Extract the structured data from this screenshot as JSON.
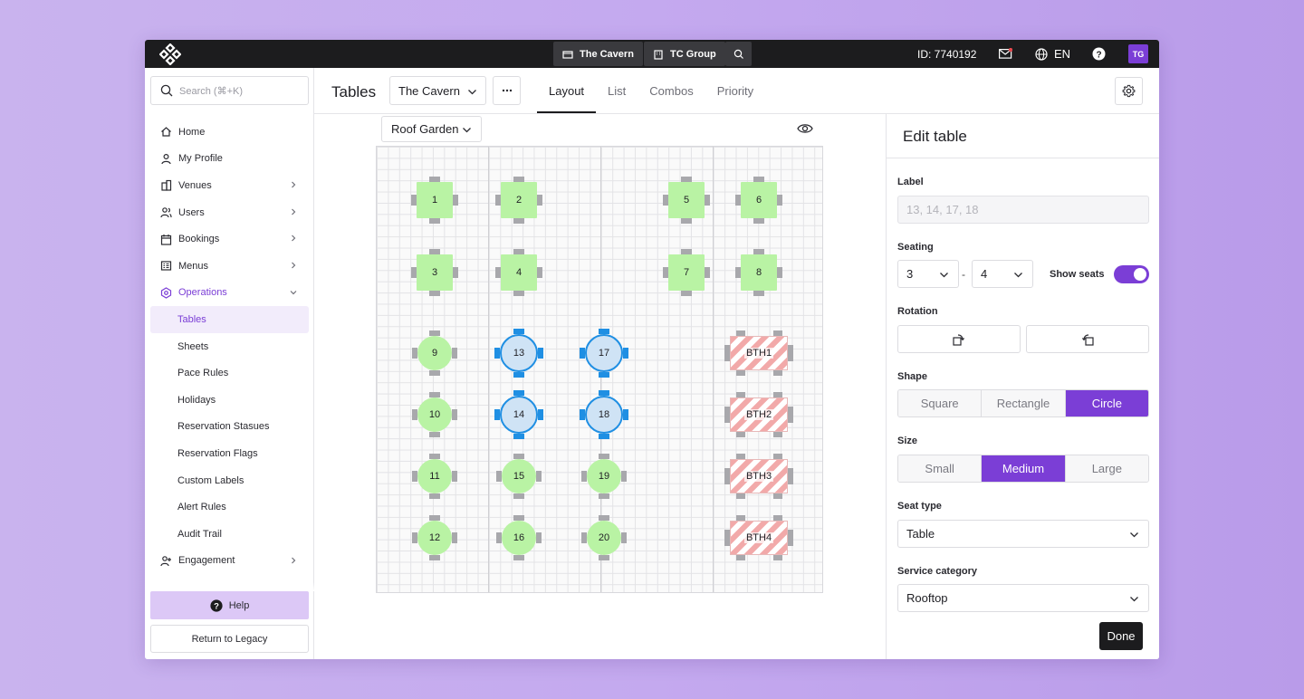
{
  "topbar": {
    "venue_label": "The Cavern",
    "group_label": "TC Group",
    "id_label": "ID: 7740192",
    "language": "EN",
    "avatar_initials": "TG"
  },
  "sidebar": {
    "search_placeholder": "Search (⌘+K)",
    "items": [
      {
        "label": "Home",
        "icon": "home-icon"
      },
      {
        "label": "My Profile",
        "icon": "person-icon"
      },
      {
        "label": "Venues",
        "icon": "building-icon",
        "chevron": true
      },
      {
        "label": "Users",
        "icon": "users-icon",
        "chevron": true
      },
      {
        "label": "Bookings",
        "icon": "calendar-icon",
        "chevron": true
      },
      {
        "label": "Menus",
        "icon": "menu-book-icon",
        "chevron": true
      },
      {
        "label": "Operations",
        "icon": "operations-icon",
        "expanded": true
      },
      {
        "label": "Tables",
        "sub": true,
        "selected": true
      },
      {
        "label": "Sheets",
        "sub": true
      },
      {
        "label": "Pace Rules",
        "sub": true
      },
      {
        "label": "Holidays",
        "sub": true
      },
      {
        "label": "Reservation Stasues",
        "sub": true
      },
      {
        "label": "Reservation Flags",
        "sub": true
      },
      {
        "label": "Custom Labels",
        "sub": true
      },
      {
        "label": "Alert Rules",
        "sub": true
      },
      {
        "label": "Audit Trail",
        "sub": true
      },
      {
        "label": "Engagement",
        "icon": "engagement-icon",
        "chevron": true
      }
    ],
    "help_label": "Help",
    "legacy_label": "Return to Legacy"
  },
  "header": {
    "title": "Tables",
    "venue_select": "The Cavern",
    "tabs": [
      "Layout",
      "List",
      "Combos",
      "Priority"
    ],
    "active_tab": "Layout"
  },
  "canvas": {
    "floor": "Roof Garden",
    "tables": [
      {
        "label": "1",
        "shape": "square",
        "status": "green",
        "col": 0,
        "row": 0
      },
      {
        "label": "2",
        "shape": "square",
        "status": "green",
        "col": 1,
        "row": 0
      },
      {
        "label": "5",
        "shape": "square",
        "status": "green",
        "col": 3,
        "row": 0
      },
      {
        "label": "6",
        "shape": "square",
        "status": "green",
        "col": 4,
        "row": 0
      },
      {
        "label": "3",
        "shape": "square",
        "status": "green",
        "col": 0,
        "row": 1
      },
      {
        "label": "4",
        "shape": "square",
        "status": "green",
        "col": 1,
        "row": 1
      },
      {
        "label": "7",
        "shape": "square",
        "status": "green",
        "col": 3,
        "row": 1
      },
      {
        "label": "8",
        "shape": "square",
        "status": "green",
        "col": 4,
        "row": 1
      },
      {
        "label": "9",
        "shape": "circle-small",
        "status": "green",
        "col": 0,
        "row": 2
      },
      {
        "label": "13",
        "shape": "circle",
        "status": "selected",
        "col": 1,
        "row": 2
      },
      {
        "label": "17",
        "shape": "circle",
        "status": "selected",
        "col": 2,
        "row": 2
      },
      {
        "label": "BTH1",
        "shape": "booth",
        "status": "blocked",
        "col": 4,
        "row": 2
      },
      {
        "label": "10",
        "shape": "circle-small",
        "status": "green",
        "col": 0,
        "row": 3
      },
      {
        "label": "14",
        "shape": "circle",
        "status": "selected",
        "col": 1,
        "row": 3
      },
      {
        "label": "18",
        "shape": "circle",
        "status": "selected",
        "col": 2,
        "row": 3
      },
      {
        "label": "BTH2",
        "shape": "booth",
        "status": "blocked",
        "col": 4,
        "row": 3
      },
      {
        "label": "11",
        "shape": "circle-small",
        "status": "green",
        "col": 0,
        "row": 4
      },
      {
        "label": "15",
        "shape": "circle-small",
        "status": "green",
        "col": 1,
        "row": 4
      },
      {
        "label": "19",
        "shape": "circle-small",
        "status": "green",
        "col": 2,
        "row": 4
      },
      {
        "label": "BTH3",
        "shape": "booth",
        "status": "blocked",
        "col": 4,
        "row": 4
      },
      {
        "label": "12",
        "shape": "circle-small",
        "status": "green",
        "col": 0,
        "row": 5
      },
      {
        "label": "16",
        "shape": "circle-small",
        "status": "green",
        "col": 1,
        "row": 5
      },
      {
        "label": "20",
        "shape": "circle-small",
        "status": "green",
        "col": 2,
        "row": 5
      },
      {
        "label": "BTH4",
        "shape": "booth",
        "status": "blocked",
        "col": 4,
        "row": 5
      }
    ]
  },
  "panel": {
    "title": "Edit table",
    "label_heading": "Label",
    "label_placeholder": "13, 14, 17, 18",
    "seating_heading": "Seating",
    "seating_min": "3",
    "seating_max": "4",
    "seating_separator": "-",
    "show_seats_label": "Show seats",
    "show_seats_on": true,
    "rotation_heading": "Rotation",
    "shape_heading": "Shape",
    "shape_options": [
      "Square",
      "Rectangle",
      "Circle"
    ],
    "shape_selected": "Circle",
    "size_heading": "Size",
    "size_options": [
      "Small",
      "Medium",
      "Large"
    ],
    "size_selected": "Medium",
    "seat_type_heading": "Seat type",
    "seat_type_value": "Table",
    "service_category_heading": "Service category",
    "service_category_value": "Rooftop",
    "done_label": "Done"
  },
  "colors": {
    "accent": "#7b3ed6",
    "table_green": "#b9f3a4",
    "table_selected": "#cfe3f5",
    "selected_seat": "#1f8fe3",
    "blocked_stripe": "#f2a9a9",
    "topbar": "#1c1c1e"
  }
}
